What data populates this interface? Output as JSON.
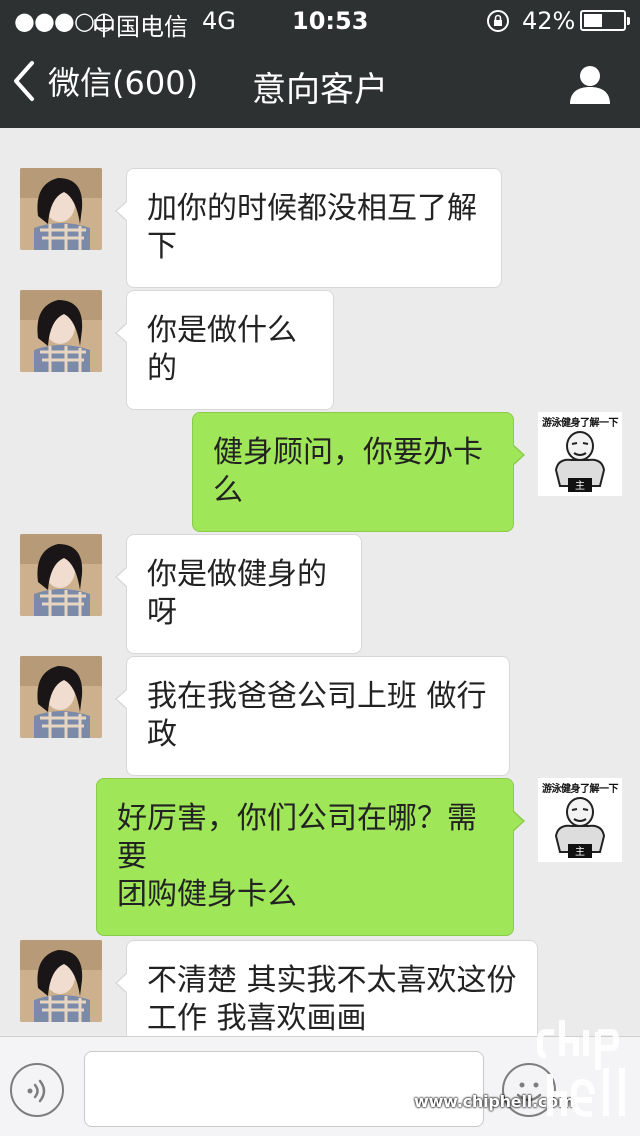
{
  "status_bar": {
    "signal": "●●●○○",
    "carrier": "中国电信",
    "network": "4G",
    "time": "10:53",
    "battery": "42%"
  },
  "nav": {
    "back_label": "微信(600)",
    "title": "意向客户",
    "back_icon": "chevron-left-icon",
    "profile_icon": "person-icon"
  },
  "messages": [
    {
      "side": "in",
      "text": "加你的时候都没相互了解下"
    },
    {
      "side": "in",
      "text": "你是做什么的"
    },
    {
      "side": "out",
      "text": "健身顾问，你要办卡么",
      "sticker": "游泳健身了解一下"
    },
    {
      "side": "in",
      "text": "你是做健身的呀"
    },
    {
      "side": "in",
      "text": "我在我爸爸公司上班 做行政"
    },
    {
      "side": "out",
      "text_lines": [
        "好厉害，你们公司在哪？需要",
        "团购健身卡么"
      ],
      "sticker": "游泳健身了解一下"
    },
    {
      "side": "in",
      "text_lines": [
        "不清楚 其实我不太喜欢这份",
        "工作 我喜欢画画"
      ]
    }
  ],
  "input_bar": {
    "voice_icon": "voice-icon",
    "emoji_icon": "emoji-icon",
    "text_value": ""
  },
  "watermark": {
    "url": "www.chiphell.com"
  },
  "colors": {
    "nav_bg": "#2e3132",
    "chat_bg": "#ebebeb",
    "bubble_out": "#9fe658",
    "bubble_in": "#ffffff"
  }
}
